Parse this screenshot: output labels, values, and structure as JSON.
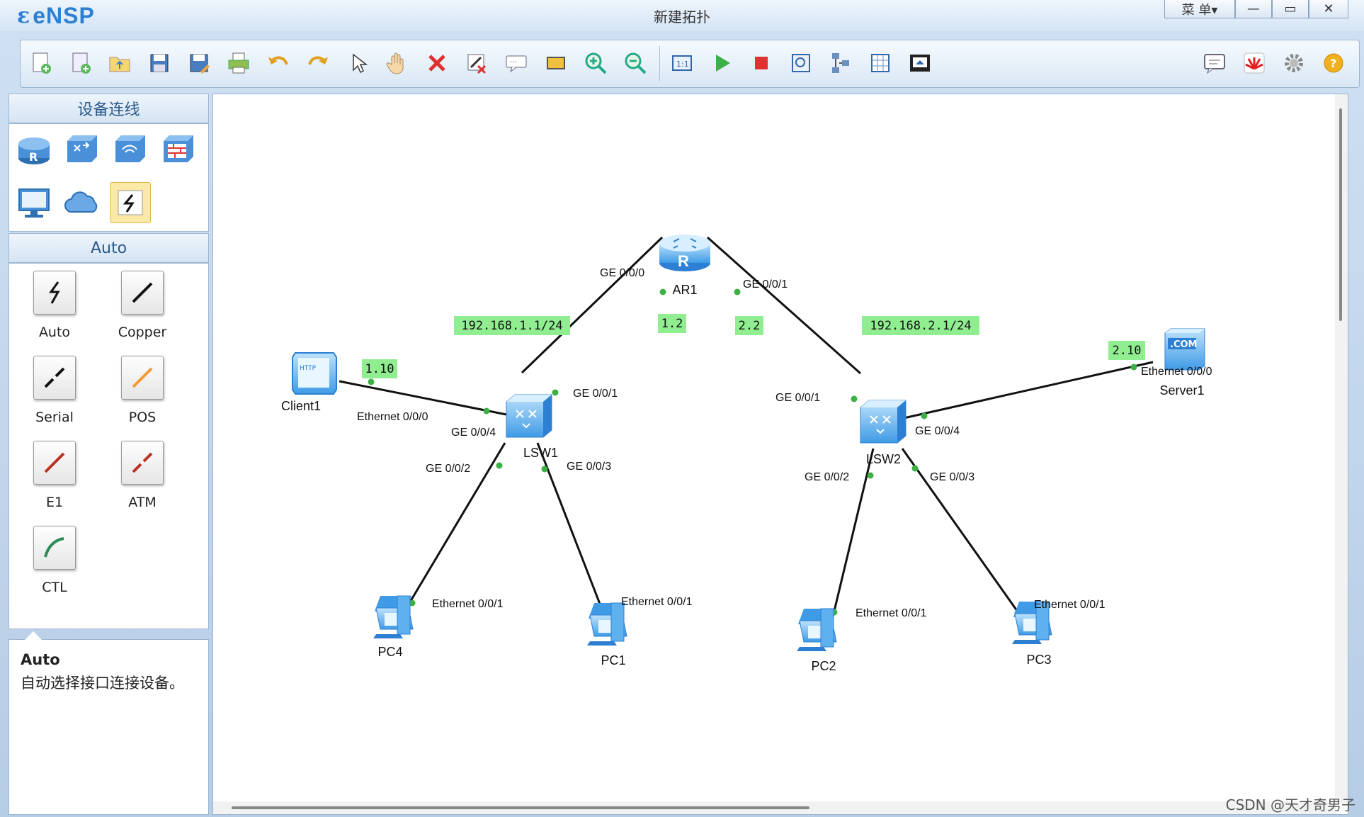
{
  "app": {
    "logo": "eNSP",
    "window_title": "新建拓扑",
    "menu_label": "菜 单▾"
  },
  "window_controls": [
    "minimize",
    "maximize",
    "close"
  ],
  "toolbar": {
    "left_icons": [
      "new-topology-icon",
      "new-example-icon",
      "open-icon",
      "save-icon",
      "save-as-icon",
      "print-icon",
      "undo-icon",
      "redo-icon",
      "select-pointer-icon",
      "pan-hand-icon",
      "delete-icon",
      "delete-link-icon",
      "text-note-icon",
      "rectangle-icon",
      "zoom-in-icon",
      "zoom-out-icon",
      "fit-icon",
      "start-device-icon",
      "stop-device-icon",
      "capture-icon",
      "topology-icon",
      "grid-icon",
      "screenshot-icon"
    ],
    "right_icons": [
      "chat-icon",
      "huawei-icon",
      "settings-icon",
      "help-icon"
    ]
  },
  "left_panel": {
    "devices_header": "设备连线",
    "device_icons": [
      "router-icon",
      "switch-icon",
      "wireless-icon",
      "firewall-icon",
      "pc-icon",
      "cloud-icon",
      "connection-icon"
    ],
    "cables_header": "Auto",
    "cables": [
      {
        "label": "Auto"
      },
      {
        "label": "Copper"
      },
      {
        "label": "Serial"
      },
      {
        "label": "POS"
      },
      {
        "label": "E1"
      },
      {
        "label": "ATM"
      },
      {
        "label": "CTL"
      }
    ],
    "description": {
      "title": "Auto",
      "text": "自动选择接口连接设备。"
    }
  },
  "topology": {
    "nodes": [
      {
        "label": "AR1"
      },
      {
        "label": "LSW1"
      },
      {
        "label": "LSW2"
      },
      {
        "label": "Client1"
      },
      {
        "label": "Server1"
      },
      {
        "label": "PC4"
      },
      {
        "label": "PC1"
      },
      {
        "label": "PC2"
      },
      {
        "label": "PC3"
      }
    ],
    "port_labels": [
      "GE 0/0/0",
      "GE 0/0/1",
      "GE 0/0/1",
      "GE 0/0/1",
      "GE 0/0/4",
      "GE 0/0/2",
      "GE 0/0/3",
      "Ethernet 0/0/0",
      "GE 0/0/4",
      "GE 0/0/2",
      "GE 0/0/3",
      "Ethernet 0/0/0",
      "Ethernet 0/0/1",
      "Ethernet 0/0/1",
      "Ethernet 0/0/1",
      "Ethernet 0/0/1"
    ],
    "notes": [
      "192.168.1.1/24",
      "1.2",
      "2.2",
      "192.168.2.1/24",
      "1.10",
      "2.10"
    ]
  },
  "watermark": "CSDN @天才奇男子",
  "colors": {
    "note_bg": "#90ee90",
    "link_end": "#3cb043",
    "accent": "#2d7fd3"
  }
}
